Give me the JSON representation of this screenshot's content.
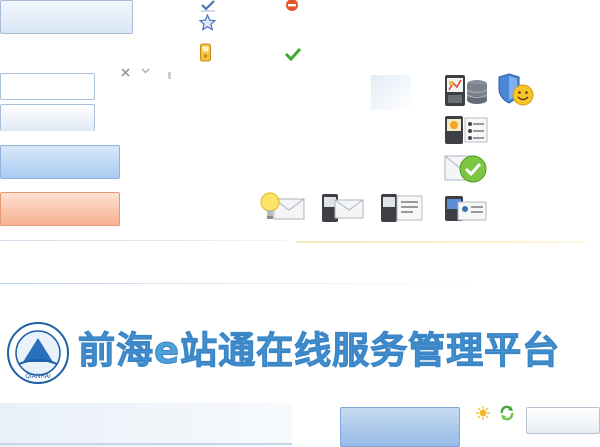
{
  "banner": {
    "title": "前海e站通在线服务管理平台",
    "logo_text": "QIANHAI"
  },
  "icons": [
    "checkmark-icon",
    "minus-circle-icon",
    "star-icon",
    "mobile-phone-icon",
    "green-check-icon",
    "close-icon",
    "chevron-down-icon",
    "grip-icon",
    "phone-chart-icon",
    "database-icon",
    "shield-icon",
    "smiley-icon",
    "contacts-icon",
    "envelope-check-icon",
    "bulb-mail-icon",
    "phone-mail-icon",
    "phone-card-icon",
    "id-card-icon",
    "sun-icon",
    "refresh-icon"
  ],
  "colors": {
    "brand_blue": "#4f9fd9",
    "button_blue": "#a9cbf1",
    "button_orange": "#f7b190",
    "success_green": "#3aaa35"
  }
}
